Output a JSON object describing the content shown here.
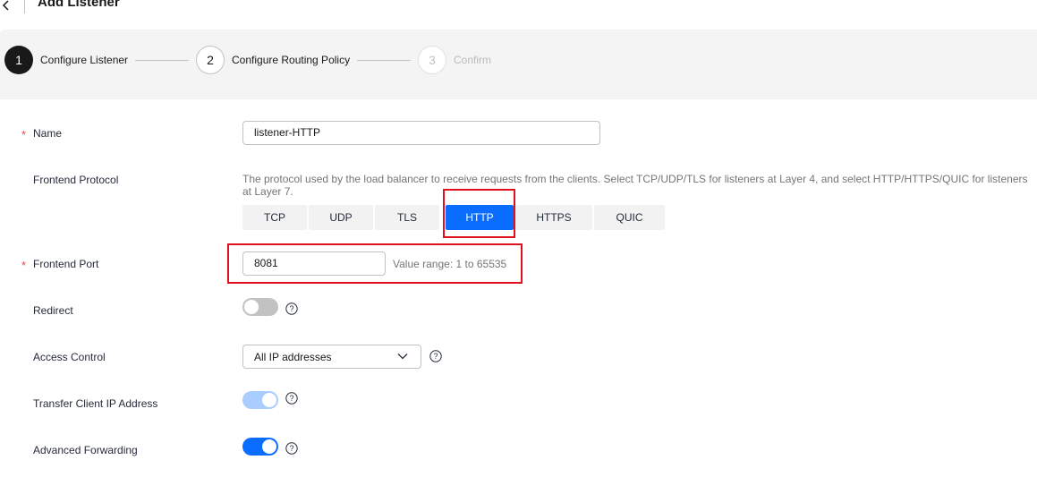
{
  "header": {
    "title": "Add Listener",
    "back_icon": "chevron-left-icon"
  },
  "steps": [
    {
      "number": "1",
      "label": "Configure Listener",
      "state": "active"
    },
    {
      "number": "2",
      "label": "Configure Routing Policy",
      "state": "normal"
    },
    {
      "number": "3",
      "label": "Confirm",
      "state": "disabled"
    }
  ],
  "form": {
    "name": {
      "label": "Name",
      "required": true,
      "value": "listener-HTTP"
    },
    "protocol": {
      "label": "Frontend Protocol",
      "hint": "The protocol used by the load balancer to receive requests from the clients. Select TCP/UDP/TLS for listeners at Layer 4, and select HTTP/HTTPS/QUIC for listeners at Layer 7.",
      "options": [
        "TCP",
        "UDP",
        "TLS",
        "HTTP",
        "HTTPS",
        "QUIC"
      ],
      "selected": "HTTP"
    },
    "port": {
      "label": "Frontend Port",
      "required": true,
      "value": "8081",
      "range_hint": "Value range: 1 to 65535"
    },
    "redirect": {
      "label": "Redirect",
      "enabled": false
    },
    "access_control": {
      "label": "Access Control",
      "value": "All IP addresses"
    },
    "transfer_ip": {
      "label": "Transfer Client IP Address",
      "enabled": true,
      "disabled": true
    },
    "advanced_forwarding": {
      "label": "Advanced Forwarding",
      "enabled": true
    }
  },
  "colors": {
    "primary": "#0a6dff",
    "required": "#e54545",
    "highlight": "#e0111d",
    "step_active": "#191919"
  }
}
